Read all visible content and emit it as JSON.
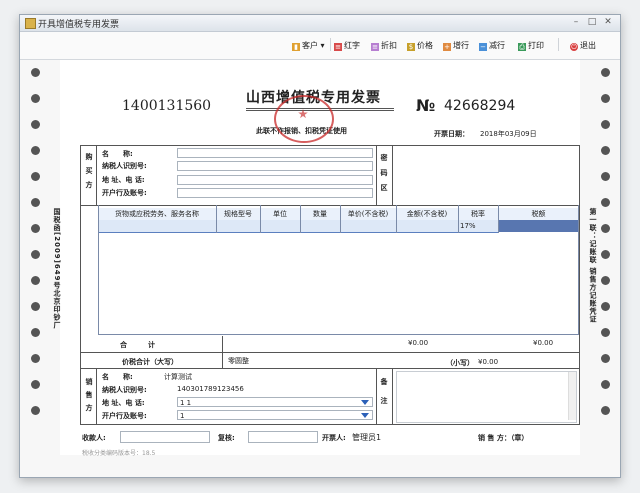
{
  "window": {
    "title": "开具增值税专用发票"
  },
  "toolbar": {
    "customer": "客户",
    "red": "红字",
    "discount": "折扣",
    "price": "价格",
    "add_row": "增行",
    "del_row": "减行",
    "print": "打印",
    "exit": "退出"
  },
  "invoice": {
    "code": "1400131560",
    "title": "山西增值税专用发票",
    "no_symbol": "№",
    "number": "42668294",
    "subtitle": "此联不作报销、扣税凭证使用",
    "date_label": "开票日期：",
    "date": "2018年03月09日",
    "side_left": "国税函[2009]649号北京印钞厂",
    "side_right": "第一联：记账联  销售方记账凭证",
    "buyer": {
      "section": "购买方",
      "name_label": "名　　称:",
      "tax_label": "纳税人识别号:",
      "addr_label": "地 址、电 话:",
      "bank_label": "开户行及账号:",
      "code_area": "密码区"
    },
    "columns": [
      "货物或应税劳务、服务名称",
      "规格型号",
      "单位",
      "数量",
      "单价(不含税)",
      "金额(不含税)",
      "税率",
      "税额"
    ],
    "row1_rate": "17%",
    "total_label": "合　　　计",
    "total_amount": "¥0.00",
    "total_tax": "¥0.00",
    "grand_label": "价税合计（大写）",
    "grand_upper": "零圆整",
    "grand_lower_label": "（小写）",
    "grand_lower": "¥0.00",
    "seller": {
      "section": "销售方",
      "name_label": "名　　称:",
      "name": "计算测试",
      "tax_label": "纳税人识别号:",
      "tax_id": "140301789123456",
      "addr_label": "地 址、电 话:",
      "addr": "1 1",
      "bank_label": "开户行及账号:",
      "bank": "1",
      "remark_label": "备注"
    },
    "footer": {
      "payee_label": "收款人:",
      "reviewer_label": "复核:",
      "drawer_label": "开票人:",
      "drawer": "管理员1",
      "seller_sign": "销 售 方：（章）",
      "version": "税收分类编码版本号：18.5"
    }
  }
}
